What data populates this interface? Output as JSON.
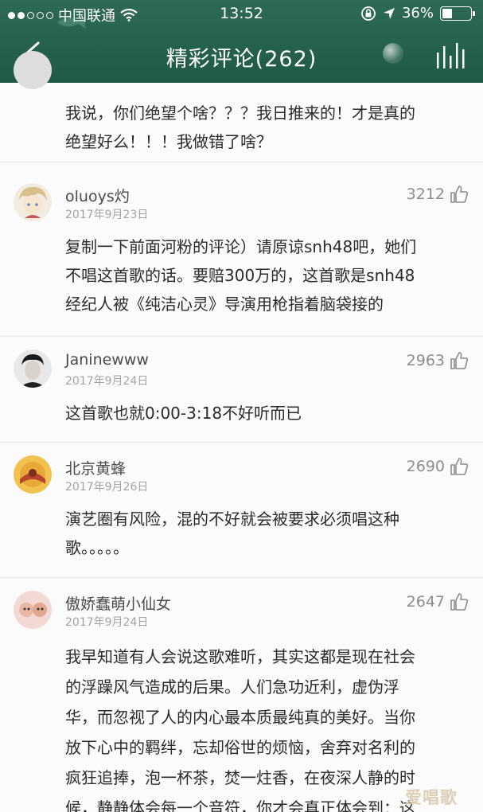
{
  "status_bar": {
    "carrier": "中国联通",
    "time": "13:52",
    "battery": "36%",
    "battery_level": 0.36
  },
  "navbar": {
    "title": "精彩评论(262)"
  },
  "top_partial_comment": {
    "lines": [
      "我说，你们绝望个啥？？？我日推来的！才是真的",
      "绝望好么！！！我做错了啥？"
    ]
  },
  "comments": [
    {
      "username": "oluoys灼",
      "date": "2017年9月23日",
      "likes": "3212",
      "lines": [
        "复制一下前面河粉的评论）请原谅snh48吧，她们",
        "不唱这首歌的话。要赔300万的，这首歌是snh48",
        "经纪人被《纯洁心灵》导演用枪指着脑袋接的"
      ]
    },
    {
      "username": "Janinewww",
      "date": "2017年9月24日",
      "likes": "2963",
      "lines": [
        "这首歌也就0:00-3:18不好听而已"
      ]
    },
    {
      "username": "北京黄蜂",
      "date": "2017年9月26日",
      "likes": "2690",
      "lines": [
        "演艺圈有风险，混的不好就会被要求必须唱这种",
        "歌。。。。。"
      ]
    },
    {
      "username": "傲娇蠢萌小仙女",
      "date": "2017年9月24日",
      "likes": "2647",
      "lines": [
        "我早知道有人会说这歌难听，其实这都是现在社会",
        "的浮躁风气造成的后果。人们急功近利，虚伪浮",
        "华，而忽视了人的内心最本质最纯真的美好。当你",
        "放下心中的羁绊，忘却俗世的烦恼，舍弃对名利的",
        "疯狂追捧，泡一杯茶，焚一炷香，在夜深人静的时",
        "候，静静体会每一个音符，你才会真正体会到：这"
      ]
    }
  ],
  "watermark": "爱唱歌",
  "colors": {
    "header_bg": "#24604b",
    "text": "#2a2a2a",
    "meta": "#a3a3a3"
  }
}
